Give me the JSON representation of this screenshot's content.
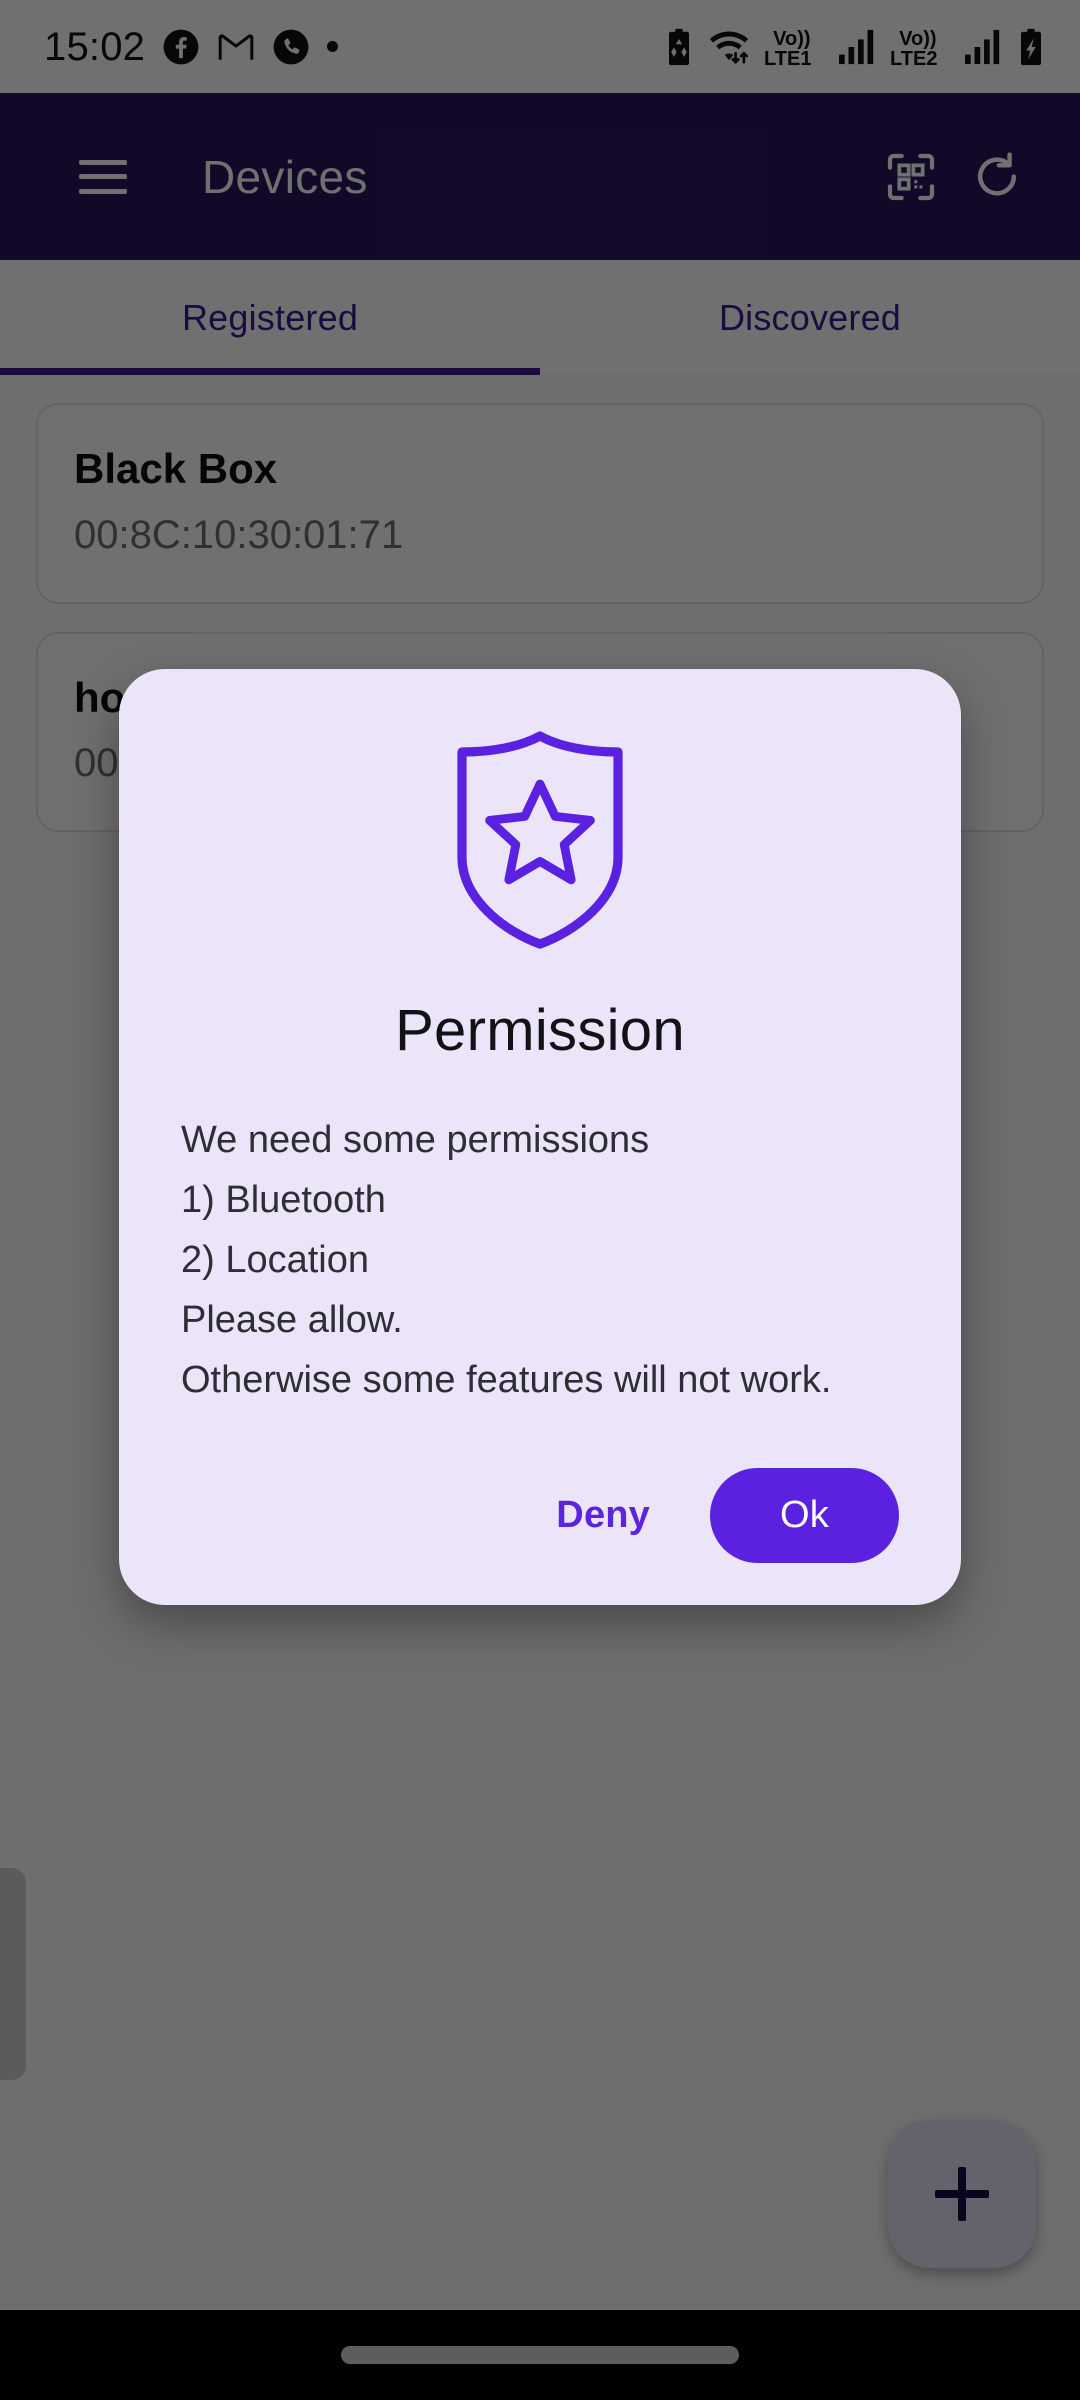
{
  "status_bar": {
    "time": "15:02",
    "left_icons": [
      "facebook-icon",
      "gmail-icon",
      "phone-icon",
      "dot-icon"
    ],
    "right_icons": [
      "battery-saver-icon",
      "wifi-icon",
      "volte1-icon",
      "signal1-icon",
      "volte2-icon",
      "signal2-icon",
      "battery-charging-icon"
    ],
    "volte1_label_top": "Vo))",
    "volte1_label_bottom": "LTE1",
    "volte2_label_top": "Vo))",
    "volte2_label_bottom": "LTE2"
  },
  "app_bar": {
    "title": "Devices",
    "menu_icon": "hamburger-menu-icon",
    "scan_icon": "qr-scan-icon",
    "refresh_icon": "refresh-icon",
    "background": "#2b155e"
  },
  "tabs": [
    {
      "label": "Registered",
      "active": true
    },
    {
      "label": "Discovered",
      "active": false
    }
  ],
  "devices": [
    {
      "name": "Black Box",
      "mac": "00:8C:10:30:01:71"
    },
    {
      "name": "ho",
      "mac": "00"
    }
  ],
  "fab": {
    "icon": "plus-icon",
    "label": "+"
  },
  "dialog": {
    "icon": "shield-star-icon",
    "title": "Permission",
    "body": "We need some permissions\n1) Bluetooth\n2) Location\nPlease allow.\nOtherwise some features will not work.",
    "deny_label": "Deny",
    "ok_label": "Ok",
    "background": "#ece4f9",
    "accent": "#5b21e0"
  },
  "nav_bar": {
    "gesture_pill": "home-gesture-pill"
  }
}
